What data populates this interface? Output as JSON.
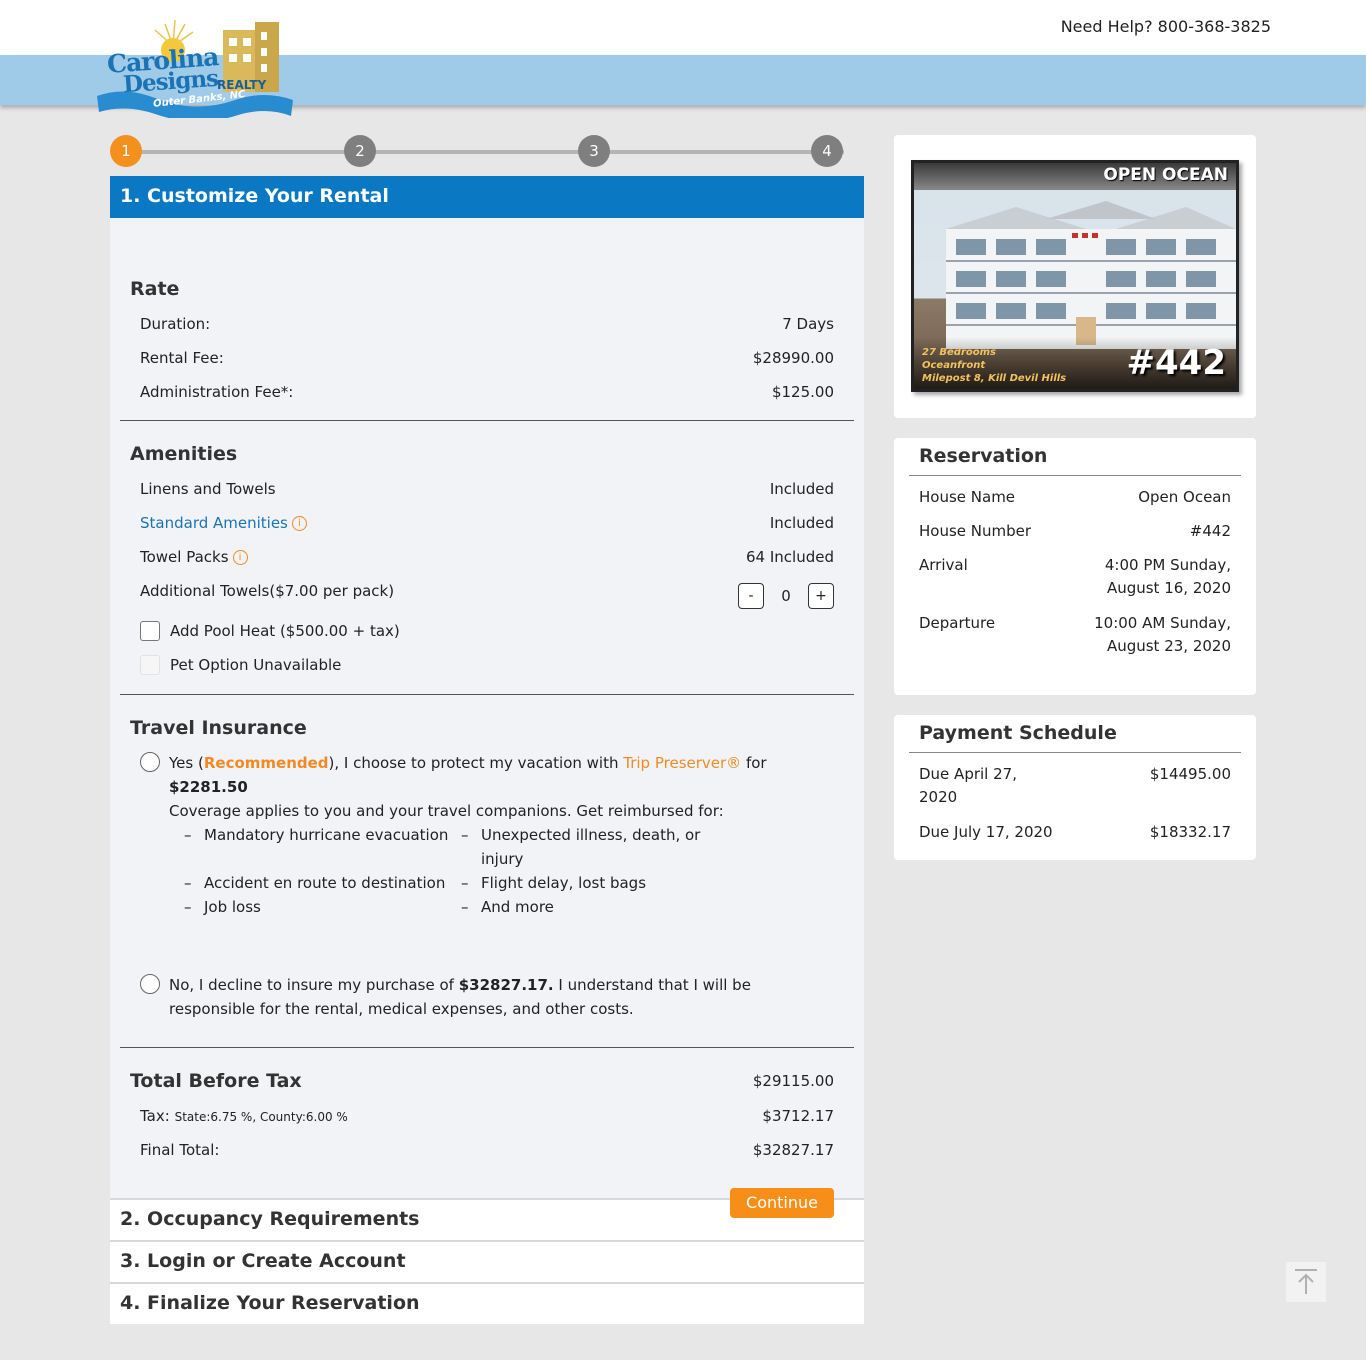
{
  "header": {
    "help_text": "Need Help? 800-368-3825",
    "logo": {
      "line1": "Carolina",
      "line2": "Designs",
      "realty": "REALTY",
      "location": "Outer Banks, NC"
    }
  },
  "steps": [
    "1",
    "2",
    "3",
    "4"
  ],
  "section1": {
    "title": "1. Customize Your Rental",
    "rate": {
      "heading": "Rate",
      "rows": [
        {
          "label": "Duration:",
          "value": "7 Days"
        },
        {
          "label": "Rental Fee:",
          "value": "$28990.00"
        },
        {
          "label": "Administration Fee*:",
          "value": "$125.00"
        }
      ]
    },
    "amenities": {
      "heading": "Amenities",
      "linens_label": "Linens and Towels",
      "linens_value": "Included",
      "standard_label": "Standard Amenities",
      "standard_value": "Included",
      "towel_packs_label": "Towel Packs",
      "towel_packs_value": "64 Included",
      "additional_label": "Additional Towels($7.00 per pack)",
      "additional_qty": "0",
      "minus": "-",
      "plus": "+",
      "pool_heat": "Add Pool Heat ($500.00 + tax)",
      "pet_option": "Pet Option Unavailable",
      "info_glyph": "i"
    },
    "insurance": {
      "heading": "Travel Insurance",
      "yes_prefix": "Yes (",
      "recommended": "Recommended",
      "yes_middle": "), I choose to protect my vacation with ",
      "trip_preserver": "Trip Preserver®",
      "yes_for": " for",
      "yes_amount": "$2281.50",
      "coverage": "Coverage applies to you and your travel companions. Get reimbursed for:",
      "bullets": [
        "Mandatory hurricane evacuation",
        "Unexpected illness, death, or injury",
        "Accident en route to destination",
        "Flight delay, lost bags",
        "Job loss",
        "And more"
      ],
      "dash": "–",
      "no_prefix": "No, I decline to insure my purchase of ",
      "no_amount": "$32827.17.",
      "no_suffix": " I understand that I will be responsible for the rental, medical expenses, and other costs."
    },
    "totals": {
      "heading": "Total Before Tax",
      "total_before_tax": "$29115.00",
      "tax_label": "Tax:",
      "tax_detail": "State:6.75 %, County:6.00 %",
      "tax_value": "$3712.17",
      "final_label": "Final Total:",
      "final_value": "$32827.17"
    },
    "continue_label": "Continue"
  },
  "collapsed_sections": [
    "2. Occupancy Requirements",
    "3. Login or Create Account",
    "4. Finalize Your Reservation"
  ],
  "property": {
    "name_banner": "OPEN OCEAN",
    "info_lines": [
      "27 Bedrooms",
      "Oceanfront",
      "Milepost 8, Kill Devil Hills"
    ],
    "number": "#442"
  },
  "reservation": {
    "title": "Reservation",
    "rows": [
      {
        "label": "House Name",
        "value": "Open Ocean"
      },
      {
        "label": "House Number",
        "value": "#442"
      },
      {
        "label": "Arrival",
        "value": "4:00 PM Sunday, August 16, 2020"
      },
      {
        "label": "Departure",
        "value": "10:00 AM Sunday, August 23, 2020"
      }
    ]
  },
  "payment_schedule": {
    "title": "Payment Schedule",
    "rows": [
      {
        "label": "Due April 27, 2020",
        "value": "$14495.00"
      },
      {
        "label": "Due July 17, 2020",
        "value": "$18332.17"
      }
    ]
  },
  "icons": {
    "scroll_top": "arrow-up-to-line-icon",
    "info": "info-circle-icon"
  },
  "colors": {
    "primary_blue": "#0a78c2",
    "accent_orange": "#f68e17",
    "header_blue": "#9fcae8"
  }
}
